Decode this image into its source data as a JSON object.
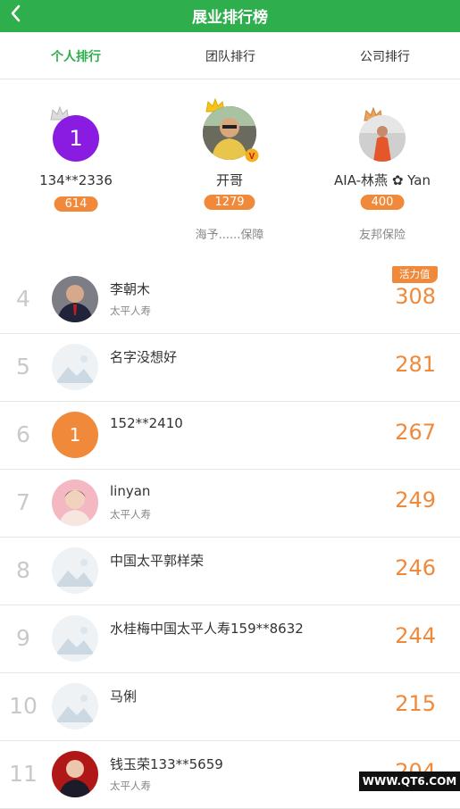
{
  "header": {
    "title": "展业排行榜"
  },
  "tabs": [
    {
      "label": "个人排行",
      "active": true
    },
    {
      "label": "团队排行",
      "active": false
    },
    {
      "label": "公司排行",
      "active": false
    }
  ],
  "podium": [
    {
      "place": 2,
      "avatar_text": "1",
      "name": "134**2336",
      "score": "614",
      "company": ""
    },
    {
      "place": 1,
      "avatar_text": "",
      "name": "开哥",
      "score": "1279",
      "company": "海予......保障"
    },
    {
      "place": 3,
      "avatar_text": "",
      "name": "AIA-林燕 ✿ Yan",
      "score": "400",
      "company": "友邦保险"
    }
  ],
  "vitality_label": "活力值",
  "list": [
    {
      "rank": "4",
      "name": "李朝木",
      "company": "太平人寿",
      "score": "308",
      "avatar": "photo-man"
    },
    {
      "rank": "5",
      "name": "名字没想好",
      "company": "",
      "score": "281",
      "avatar": "placeholder"
    },
    {
      "rank": "6",
      "name": "152**2410",
      "company": "",
      "score": "267",
      "avatar": "number",
      "avatar_text": "1"
    },
    {
      "rank": "7",
      "name": "linyan",
      "company": "太平人寿",
      "score": "249",
      "avatar": "photo-woman"
    },
    {
      "rank": "8",
      "name": "中国太平郭样荣",
      "company": "",
      "score": "246",
      "avatar": "placeholder"
    },
    {
      "rank": "9",
      "name": "水桂梅中国太平人寿159**8632",
      "company": "",
      "score": "244",
      "avatar": "placeholder"
    },
    {
      "rank": "10",
      "name": "马俐",
      "company": "",
      "score": "215",
      "avatar": "placeholder"
    },
    {
      "rank": "11",
      "name": "钱玉荣133**5659",
      "company": "太平人寿",
      "score": "204",
      "avatar": "photo-red"
    }
  ],
  "watermark": "WWW.QT6.COM",
  "colors": {
    "brand_green": "#2fae4e",
    "score_orange": "#f08a3a",
    "purple": "#8a1be0"
  }
}
